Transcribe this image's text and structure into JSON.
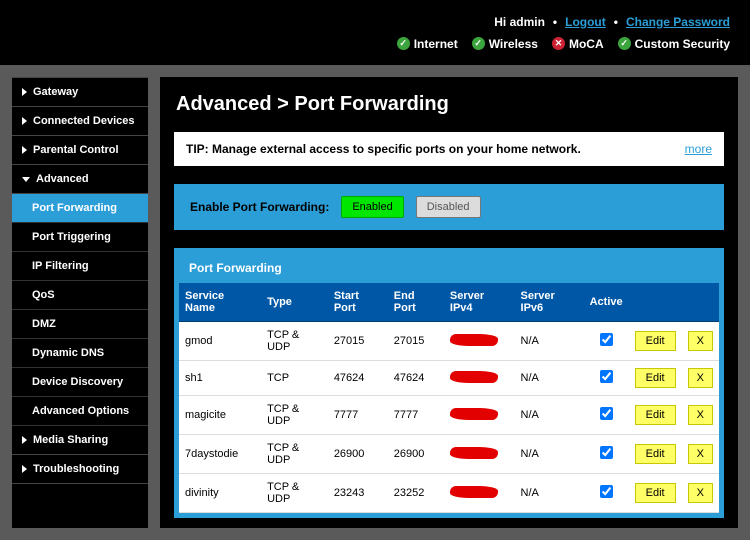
{
  "topbar": {
    "greeting": "Hi admin",
    "logout": "Logout",
    "change_pw": "Change Password",
    "statuses": [
      {
        "label": "Internet",
        "ok": true
      },
      {
        "label": "Wireless",
        "ok": true
      },
      {
        "label": "MoCA",
        "ok": false
      },
      {
        "label": "Custom Security",
        "ok": true
      }
    ]
  },
  "sidebar": {
    "top": [
      {
        "label": "Gateway"
      },
      {
        "label": "Connected Devices"
      },
      {
        "label": "Parental Control"
      }
    ],
    "advanced_label": "Advanced",
    "subs": [
      {
        "label": "Port Forwarding",
        "active": true
      },
      {
        "label": "Port Triggering"
      },
      {
        "label": "IP Filtering"
      },
      {
        "label": "QoS"
      },
      {
        "label": "DMZ"
      },
      {
        "label": "Dynamic DNS"
      },
      {
        "label": "Device Discovery"
      },
      {
        "label": "Advanced Options"
      }
    ],
    "bottom": [
      {
        "label": "Media Sharing"
      },
      {
        "label": "Troubleshooting"
      }
    ]
  },
  "page": {
    "title": "Advanced > Port Forwarding",
    "tip": "TIP: Manage external access to specific ports on your home network.",
    "more": "more",
    "enable_label": "Enable Port Forwarding:",
    "enabled": "Enabled",
    "disabled": "Disabled",
    "table_caption": "Port Forwarding",
    "columns": [
      "Service Name",
      "Type",
      "Start Port",
      "End Port",
      "Server IPv4",
      "Server IPv6",
      "Active"
    ],
    "edit_label": "Edit",
    "x_label": "X",
    "rows": [
      {
        "name": "gmod",
        "type": "TCP & UDP",
        "start": "27015",
        "end": "27015",
        "ipv6": "N/A",
        "active": true
      },
      {
        "name": "sh1",
        "type": "TCP",
        "start": "47624",
        "end": "47624",
        "ipv6": "N/A",
        "active": true
      },
      {
        "name": "magicite",
        "type": "TCP & UDP",
        "start": "7777",
        "end": "7777",
        "ipv6": "N/A",
        "active": true
      },
      {
        "name": "7daystodie",
        "type": "TCP & UDP",
        "start": "26900",
        "end": "26900",
        "ipv6": "N/A",
        "active": true
      },
      {
        "name": "divinity",
        "type": "TCP & UDP",
        "start": "23243",
        "end": "23252",
        "ipv6": "N/A",
        "active": true
      }
    ]
  }
}
